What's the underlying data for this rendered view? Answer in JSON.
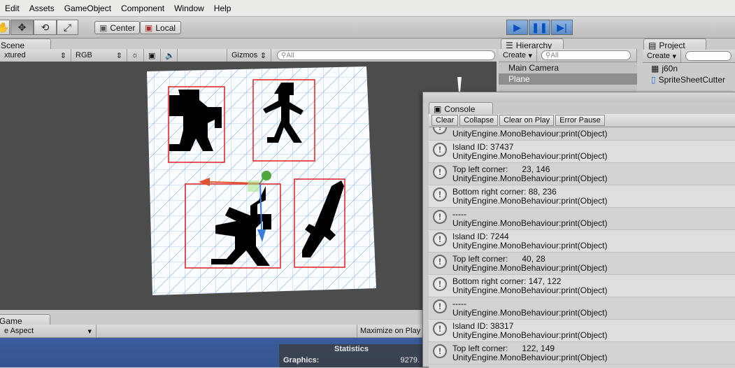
{
  "menu": [
    "Edit",
    "Assets",
    "GameObject",
    "Component",
    "Window",
    "Help"
  ],
  "toolbar": {
    "pivot": "Center",
    "space": "Local"
  },
  "scene": {
    "tab": "Scene",
    "shading": "xtured",
    "render_mode": "RGB",
    "gizmos": "Gizmos",
    "search": "All"
  },
  "hierarchy": {
    "tab": "Hierarchy",
    "create": "Create",
    "search": "All",
    "items": [
      "Main Camera",
      "Plane"
    ]
  },
  "project": {
    "tab": "Project",
    "create": "Create",
    "items": [
      "j60n",
      "SpriteSheetCutter"
    ]
  },
  "console": {
    "tab": "Console",
    "buttons": [
      "Clear",
      "Collapse",
      "Clear on Play",
      "Error Pause"
    ],
    "logs": [
      [
        "-----",
        "UnityEngine.MonoBehaviour:print(Object)"
      ],
      [
        "Island ID: 37437",
        "UnityEngine.MonoBehaviour:print(Object)"
      ],
      [
        "Top left corner:      23, 146",
        "UnityEngine.MonoBehaviour:print(Object)"
      ],
      [
        "Bottom right corner: 88, 236",
        "UnityEngine.MonoBehaviour:print(Object)"
      ],
      [
        "-----",
        "UnityEngine.MonoBehaviour:print(Object)"
      ],
      [
        "Island ID: 7244",
        "UnityEngine.MonoBehaviour:print(Object)"
      ],
      [
        "Top left corner:      40, 28",
        "UnityEngine.MonoBehaviour:print(Object)"
      ],
      [
        "Bottom right corner: 147, 122",
        "UnityEngine.MonoBehaviour:print(Object)"
      ],
      [
        "-----",
        "UnityEngine.MonoBehaviour:print(Object)"
      ],
      [
        "Island ID: 38317",
        "UnityEngine.MonoBehaviour:print(Object)"
      ],
      [
        "Top left corner:      122, 149",
        "UnityEngine.MonoBehaviour:print(Object)"
      ]
    ]
  },
  "game": {
    "tab": "Game",
    "aspect": "e Aspect",
    "maximize": "Maximize on Play",
    "stats_title": "Statistics",
    "graphics_label": "Graphics:",
    "graphics_value": "9279."
  }
}
